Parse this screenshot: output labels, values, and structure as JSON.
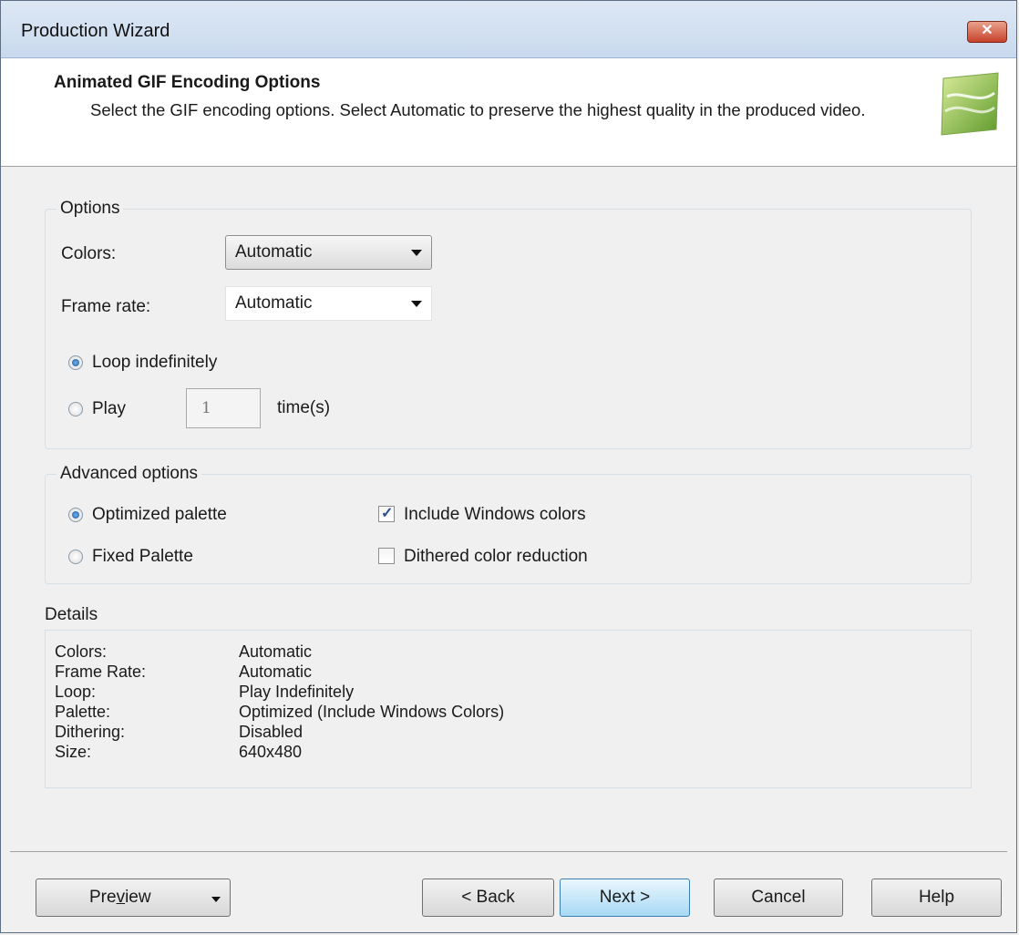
{
  "window": {
    "title": "Production Wizard",
    "close_glyph": "✕"
  },
  "header": {
    "title": "Animated GIF Encoding Options",
    "description": "Select the GIF encoding options. Select Automatic to preserve the highest quality in the produced video.",
    "logo_icon": "camtasia-wizard-logo-icon"
  },
  "options": {
    "legend": "Options",
    "colors_label": "Colors:",
    "colors_value": "Automatic",
    "frame_rate_label": "Frame rate:",
    "frame_rate_value": "Automatic",
    "loop_label": "Loop indefinitely",
    "loop_selected": true,
    "play_label": "Play",
    "play_count": "1",
    "times_label": "time(s)"
  },
  "advanced": {
    "legend": "Advanced options",
    "optimized_label": "Optimized palette",
    "optimized_selected": true,
    "fixed_label": "Fixed Palette",
    "include_windows_label": "Include Windows colors",
    "include_windows_checked": true,
    "dithered_label": "Dithered color reduction",
    "dithered_checked": false
  },
  "details": {
    "heading": "Details",
    "rows": [
      {
        "key": "Colors:",
        "value": "Automatic"
      },
      {
        "key": "Frame Rate:",
        "value": "Automatic"
      },
      {
        "key": "Loop:",
        "value": "Play Indefinitely"
      },
      {
        "key": "Palette:",
        "value": "Optimized (Include Windows Colors)"
      },
      {
        "key": "Dithering:",
        "value": "Disabled"
      },
      {
        "key": "Size:",
        "value": "640x480"
      }
    ]
  },
  "buttons": {
    "preview_pre": "Pre",
    "preview_u": "v",
    "preview_post": "iew",
    "back": "< Back",
    "next": "Next >",
    "cancel": "Cancel",
    "help": "Help"
  },
  "colors": {
    "accent": "#3c7fb1",
    "close": "#c8412c"
  }
}
